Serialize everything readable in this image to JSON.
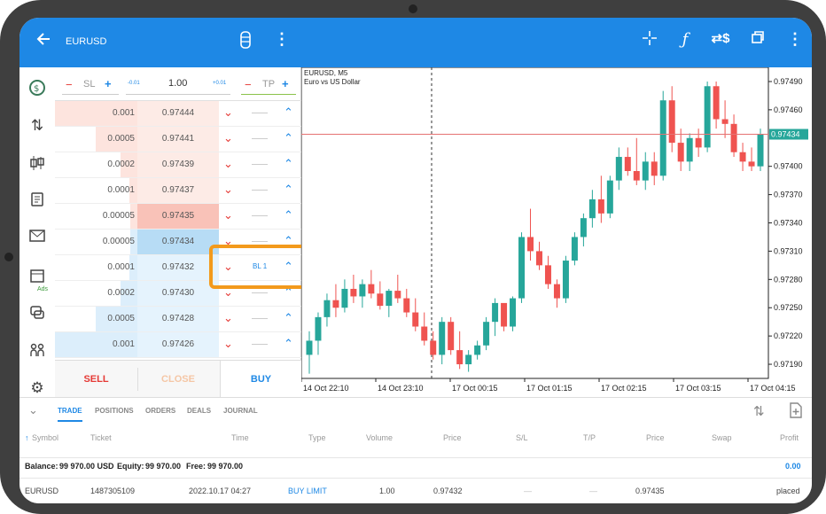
{
  "app": {
    "symbol": "EURUSD"
  },
  "toolbar": {
    "back_icon": "arrow-left-icon",
    "icons": [
      "price-cylinder-icon",
      "more-vert-icon",
      "crosshair-icon",
      "function-icon",
      "dollar-swap-icon",
      "window-icon",
      "more-vert-icon"
    ]
  },
  "sidebar": {
    "items": [
      {
        "icon": "clock-money-icon"
      },
      {
        "icon": "trade-arrows-icon"
      },
      {
        "icon": "candles-icon"
      },
      {
        "icon": "history-icon"
      },
      {
        "icon": "mail-icon"
      },
      {
        "icon": "calendar-icon",
        "label": "Ads"
      },
      {
        "icon": "chat-icon"
      },
      {
        "icon": "community-icon"
      },
      {
        "icon": "settings-icon"
      }
    ]
  },
  "trade_panel": {
    "sl_label": "SL",
    "tp_label": "TP",
    "minus": "−",
    "plus": "+",
    "volume": "1.00",
    "vol_minus": "-0.01",
    "vol_plus": "+0.01",
    "rows": [
      {
        "volume": "0.001",
        "price": "0.97444",
        "side": "ask"
      },
      {
        "volume": "0.0005",
        "price": "0.97441",
        "side": "ask"
      },
      {
        "volume": "0.0002",
        "price": "0.97439",
        "side": "ask"
      },
      {
        "volume": "0.0001",
        "price": "0.97437",
        "side": "ask"
      },
      {
        "volume": "0.00005",
        "price": "0.97435",
        "side": "ask-best"
      },
      {
        "volume": "0.00005",
        "price": "0.97434",
        "side": "bid-best"
      },
      {
        "volume": "0.0001",
        "price": "0.97432",
        "side": "bid",
        "order": "BL 1"
      },
      {
        "volume": "0.0002",
        "price": "0.97430",
        "side": "bid"
      },
      {
        "volume": "0.0005",
        "price": "0.97428",
        "side": "bid"
      },
      {
        "volume": "0.001",
        "price": "0.97426",
        "side": "bid"
      }
    ],
    "sell_label": "SELL",
    "close_label": "CLOSE",
    "buy_label": "BUY"
  },
  "chart": {
    "title": "EURUSD, M5",
    "subtitle": "Euro vs US Dollar",
    "current_price": "0.97434",
    "y_ticks": [
      "0.97490",
      "0.97460",
      "0.97400",
      "0.97370",
      "0.97340",
      "0.97310",
      "0.97280",
      "0.97250",
      "0.97220",
      "0.97190"
    ],
    "x_ticks": [
      "14 Oct 22:10",
      "14 Oct 23:10",
      "17 Oct 00:15",
      "17 Oct 01:15",
      "17 Oct 02:15",
      "17 Oct 03:15",
      "17 Oct 04:15"
    ]
  },
  "chart_data": {
    "type": "candlestick",
    "title": "EURUSD, M5",
    "ylim": [
      0.97175,
      0.97505
    ],
    "current_price": 0.97434,
    "candles": [
      {
        "o": 0.972,
        "h": 0.97225,
        "l": 0.9718,
        "c": 0.97215
      },
      {
        "o": 0.97215,
        "h": 0.97245,
        "l": 0.972,
        "c": 0.9724
      },
      {
        "o": 0.9724,
        "h": 0.97265,
        "l": 0.9723,
        "c": 0.97258
      },
      {
        "o": 0.97258,
        "h": 0.97275,
        "l": 0.9724,
        "c": 0.9725
      },
      {
        "o": 0.9725,
        "h": 0.9728,
        "l": 0.97245,
        "c": 0.9727
      },
      {
        "o": 0.9727,
        "h": 0.97285,
        "l": 0.97255,
        "c": 0.97262
      },
      {
        "o": 0.97262,
        "h": 0.9728,
        "l": 0.9725,
        "c": 0.97275
      },
      {
        "o": 0.97275,
        "h": 0.9729,
        "l": 0.9726,
        "c": 0.97265
      },
      {
        "o": 0.97265,
        "h": 0.97278,
        "l": 0.97248,
        "c": 0.97252
      },
      {
        "o": 0.97252,
        "h": 0.9727,
        "l": 0.9724,
        "c": 0.97268
      },
      {
        "o": 0.97268,
        "h": 0.97285,
        "l": 0.97255,
        "c": 0.9726
      },
      {
        "o": 0.9726,
        "h": 0.9727,
        "l": 0.9724,
        "c": 0.97245
      },
      {
        "o": 0.97245,
        "h": 0.9726,
        "l": 0.97225,
        "c": 0.9723
      },
      {
        "o": 0.9723,
        "h": 0.97245,
        "l": 0.9721,
        "c": 0.97215
      },
      {
        "o": 0.97215,
        "h": 0.97225,
        "l": 0.97195,
        "c": 0.972
      },
      {
        "o": 0.972,
        "h": 0.9724,
        "l": 0.9719,
        "c": 0.97235
      },
      {
        "o": 0.97235,
        "h": 0.9724,
        "l": 0.972,
        "c": 0.97205
      },
      {
        "o": 0.97205,
        "h": 0.97225,
        "l": 0.97185,
        "c": 0.9719
      },
      {
        "o": 0.9719,
        "h": 0.97205,
        "l": 0.97182,
        "c": 0.972
      },
      {
        "o": 0.972,
        "h": 0.97215,
        "l": 0.97195,
        "c": 0.9721
      },
      {
        "o": 0.9721,
        "h": 0.9724,
        "l": 0.97205,
        "c": 0.97235
      },
      {
        "o": 0.97235,
        "h": 0.9726,
        "l": 0.9722,
        "c": 0.97255
      },
      {
        "o": 0.97255,
        "h": 0.9725,
        "l": 0.97225,
        "c": 0.9723
      },
      {
        "o": 0.9723,
        "h": 0.97262,
        "l": 0.97225,
        "c": 0.9726
      },
      {
        "o": 0.9726,
        "h": 0.9733,
        "l": 0.97255,
        "c": 0.97325
      },
      {
        "o": 0.97325,
        "h": 0.97355,
        "l": 0.973,
        "c": 0.9731
      },
      {
        "o": 0.9731,
        "h": 0.9732,
        "l": 0.9729,
        "c": 0.97295
      },
      {
        "o": 0.97295,
        "h": 0.97305,
        "l": 0.9727,
        "c": 0.97275
      },
      {
        "o": 0.97275,
        "h": 0.9728,
        "l": 0.9725,
        "c": 0.9726
      },
      {
        "o": 0.9726,
        "h": 0.97305,
        "l": 0.97255,
        "c": 0.973
      },
      {
        "o": 0.973,
        "h": 0.9733,
        "l": 0.97295,
        "c": 0.97325
      },
      {
        "o": 0.97325,
        "h": 0.9735,
        "l": 0.97315,
        "c": 0.97345
      },
      {
        "o": 0.97345,
        "h": 0.97375,
        "l": 0.97335,
        "c": 0.97365
      },
      {
        "o": 0.97365,
        "h": 0.9739,
        "l": 0.9734,
        "c": 0.9735
      },
      {
        "o": 0.9735,
        "h": 0.9739,
        "l": 0.97345,
        "c": 0.97385
      },
      {
        "o": 0.97385,
        "h": 0.9742,
        "l": 0.97375,
        "c": 0.9741
      },
      {
        "o": 0.9741,
        "h": 0.9742,
        "l": 0.9739,
        "c": 0.97395
      },
      {
        "o": 0.97395,
        "h": 0.9743,
        "l": 0.9738,
        "c": 0.97385
      },
      {
        "o": 0.97385,
        "h": 0.97415,
        "l": 0.97375,
        "c": 0.97405
      },
      {
        "o": 0.97405,
        "h": 0.97415,
        "l": 0.9738,
        "c": 0.9739
      },
      {
        "o": 0.9739,
        "h": 0.9748,
        "l": 0.97385,
        "c": 0.9747
      },
      {
        "o": 0.9747,
        "h": 0.97485,
        "l": 0.97415,
        "c": 0.97425
      },
      {
        "o": 0.97425,
        "h": 0.9744,
        "l": 0.97395,
        "c": 0.97405
      },
      {
        "o": 0.97405,
        "h": 0.97435,
        "l": 0.97395,
        "c": 0.9743
      },
      {
        "o": 0.9743,
        "h": 0.9744,
        "l": 0.9741,
        "c": 0.9742
      },
      {
        "o": 0.9742,
        "h": 0.9749,
        "l": 0.97415,
        "c": 0.97485
      },
      {
        "o": 0.97485,
        "h": 0.9749,
        "l": 0.9744,
        "c": 0.9745
      },
      {
        "o": 0.9745,
        "h": 0.9747,
        "l": 0.9743,
        "c": 0.97445
      },
      {
        "o": 0.97445,
        "h": 0.97455,
        "l": 0.9741,
        "c": 0.97415
      },
      {
        "o": 0.97415,
        "h": 0.97425,
        "l": 0.97395,
        "c": 0.97405
      },
      {
        "o": 0.97405,
        "h": 0.9742,
        "l": 0.97395,
        "c": 0.974
      },
      {
        "o": 0.974,
        "h": 0.9744,
        "l": 0.97395,
        "c": 0.97434
      }
    ]
  },
  "bottom": {
    "tabs": [
      "TRADE",
      "POSITIONS",
      "ORDERS",
      "DEALS",
      "JOURNAL"
    ],
    "columns": [
      "Symbol",
      "Ticket",
      "Time",
      "Type",
      "Volume",
      "Price",
      "S/L",
      "T/P",
      "Price",
      "Swap",
      "Profit"
    ],
    "balance_label": "Balance:",
    "balance": "99 970.00 USD",
    "equity_label": "Equity:",
    "equity": "99 970.00",
    "free_label": "Free:",
    "free": "99 970.00",
    "total_profit": "0.00",
    "order": {
      "symbol": "EURUSD",
      "ticket": "1487305109",
      "time": "2022.10.17 04:27",
      "type": "BUY LIMIT",
      "volume": "1.00",
      "price": "0.97432",
      "sl": "—",
      "tp": "—",
      "cur_price": "0.97435",
      "swap": "",
      "status": "placed"
    }
  }
}
